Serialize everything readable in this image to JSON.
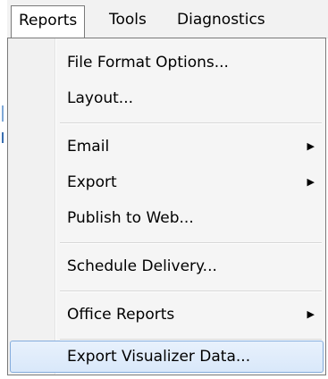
{
  "menubar": {
    "items": [
      {
        "label": "Reports"
      },
      {
        "label": "Tools"
      },
      {
        "label": "Diagnostics"
      }
    ]
  },
  "reports_menu": {
    "items": [
      {
        "label": "File Format Options..."
      },
      {
        "label": "Layout..."
      },
      {
        "label": "Email",
        "submenu_indicator": "▶"
      },
      {
        "label": "Export",
        "submenu_indicator": "▶"
      },
      {
        "label": "Publish to Web..."
      },
      {
        "label": "Schedule Delivery..."
      },
      {
        "label": "Office Reports",
        "submenu_indicator": "▶"
      },
      {
        "label": "Export Visualizer Data..."
      }
    ],
    "highlighted_item": "Export Visualizer Data..."
  },
  "colors": {
    "highlight_border": "#84acdd",
    "highlight_fill": "#dde9f9",
    "menu_background": "#f5f5f5"
  }
}
